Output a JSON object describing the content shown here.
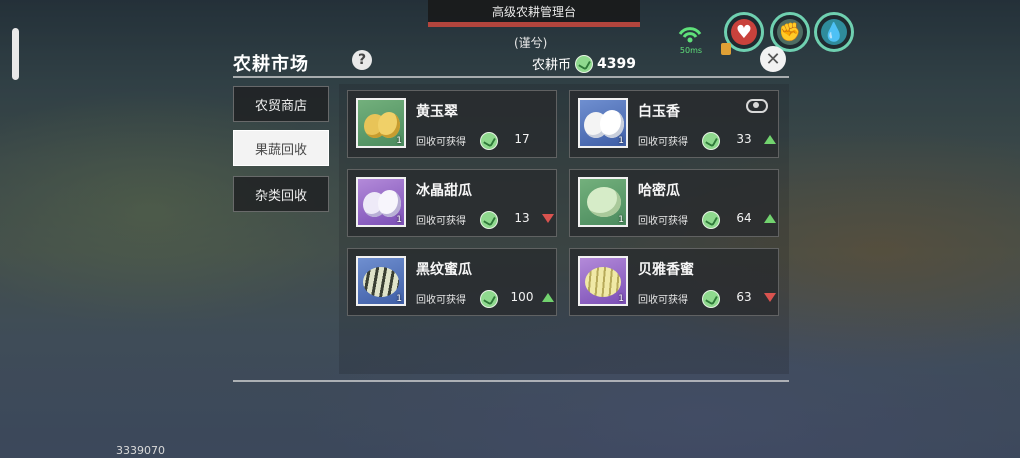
{
  "top_banner": {
    "title": "高级农耕管理台"
  },
  "guard_label": "(谨兮)",
  "status": {
    "ping": "50ms"
  },
  "panel": {
    "title": "农耕市场",
    "help": "?",
    "currency_label": "农耕币",
    "currency_value": "4399",
    "close": "✕"
  },
  "tabs": [
    {
      "label": "农贸商店",
      "active": false
    },
    {
      "label": "果蔬回收",
      "active": true
    },
    {
      "label": "杂类回收",
      "active": false
    }
  ],
  "items": [
    {
      "name": "黄玉翠",
      "reward_label": "回收可获得",
      "price": "17",
      "trend": "none",
      "count": "1",
      "bg": "green",
      "melon_color": "#e8c458"
    },
    {
      "name": "白玉香",
      "reward_label": "回收可获得",
      "price": "33",
      "trend": "up",
      "count": "1",
      "bg": "blue",
      "melon_color": "#f2f2f2"
    },
    {
      "name": "冰晶甜瓜",
      "reward_label": "回收可获得",
      "price": "13",
      "trend": "down",
      "count": "1",
      "bg": "purple",
      "melon_color": "#e9e6f4"
    },
    {
      "name": "哈密瓜",
      "reward_label": "回收可获得",
      "price": "64",
      "trend": "up",
      "count": "1",
      "bg": "green",
      "melon_color": "#cfe6c2"
    },
    {
      "name": "黑纹蜜瓜",
      "reward_label": "回收可获得",
      "price": "100",
      "trend": "up",
      "count": "1",
      "bg": "blue",
      "melon_color": "#cfd8b8"
    },
    {
      "name": "贝雅香蜜",
      "reward_label": "回收可获得",
      "price": "63",
      "trend": "down",
      "count": "1",
      "bg": "purple",
      "melon_color": "#e9e1a8"
    }
  ],
  "user_id": "3339070"
}
